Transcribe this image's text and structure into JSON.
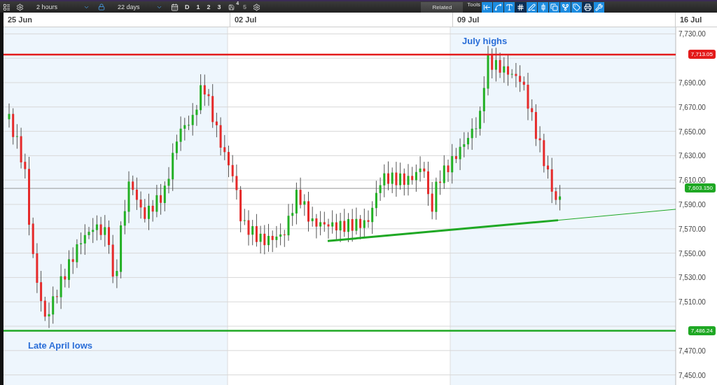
{
  "toolbar": {
    "interval": "2 hours",
    "range": "22 days",
    "periods": [
      {
        "label": "D",
        "disabled": false
      },
      {
        "label": "1",
        "disabled": false
      },
      {
        "label": "2",
        "disabled": false
      },
      {
        "label": "3",
        "disabled": false
      },
      {
        "label": "4",
        "disabled": false,
        "kind": "badge"
      },
      {
        "label": "5",
        "disabled": true
      }
    ],
    "related": "Related",
    "tools_label": "Tools",
    "tools": [
      {
        "kind": "arrow",
        "selected": false
      },
      {
        "kind": "curve",
        "selected": false
      },
      {
        "kind": "text",
        "selected": false
      },
      {
        "kind": "grid",
        "selected": true
      },
      {
        "kind": "pen",
        "selected": false
      },
      {
        "kind": "candle",
        "selected": false
      },
      {
        "kind": "layers",
        "selected": false
      },
      {
        "kind": "fork",
        "selected": false
      },
      {
        "kind": "tag",
        "selected": false
      },
      {
        "kind": "printer",
        "selected": true
      },
      {
        "kind": "settings",
        "selected": false
      }
    ]
  },
  "chart": {
    "dates": [
      "25 Jun",
      "02 Jul",
      "09 Jul",
      "16 Jul"
    ],
    "y_ticks": [
      "7,730.00",
      "7,690.00",
      "7,670.00",
      "7,650.00",
      "7,630.00",
      "7,610.00",
      "7,590.00",
      "7,570.00",
      "7,550.00",
      "7,530.00",
      "7,510.00",
      "7,470.00",
      "7,450.00"
    ],
    "price_tags": [
      {
        "label": "7,713.05",
        "color": "#e31b1b"
      },
      {
        "label": "7,603.150",
        "color": "#1fa824"
      },
      {
        "label": "7,486.24",
        "color": "#1fa824"
      }
    ],
    "annotations": [
      "July highs",
      "Late April lows"
    ]
  }
}
